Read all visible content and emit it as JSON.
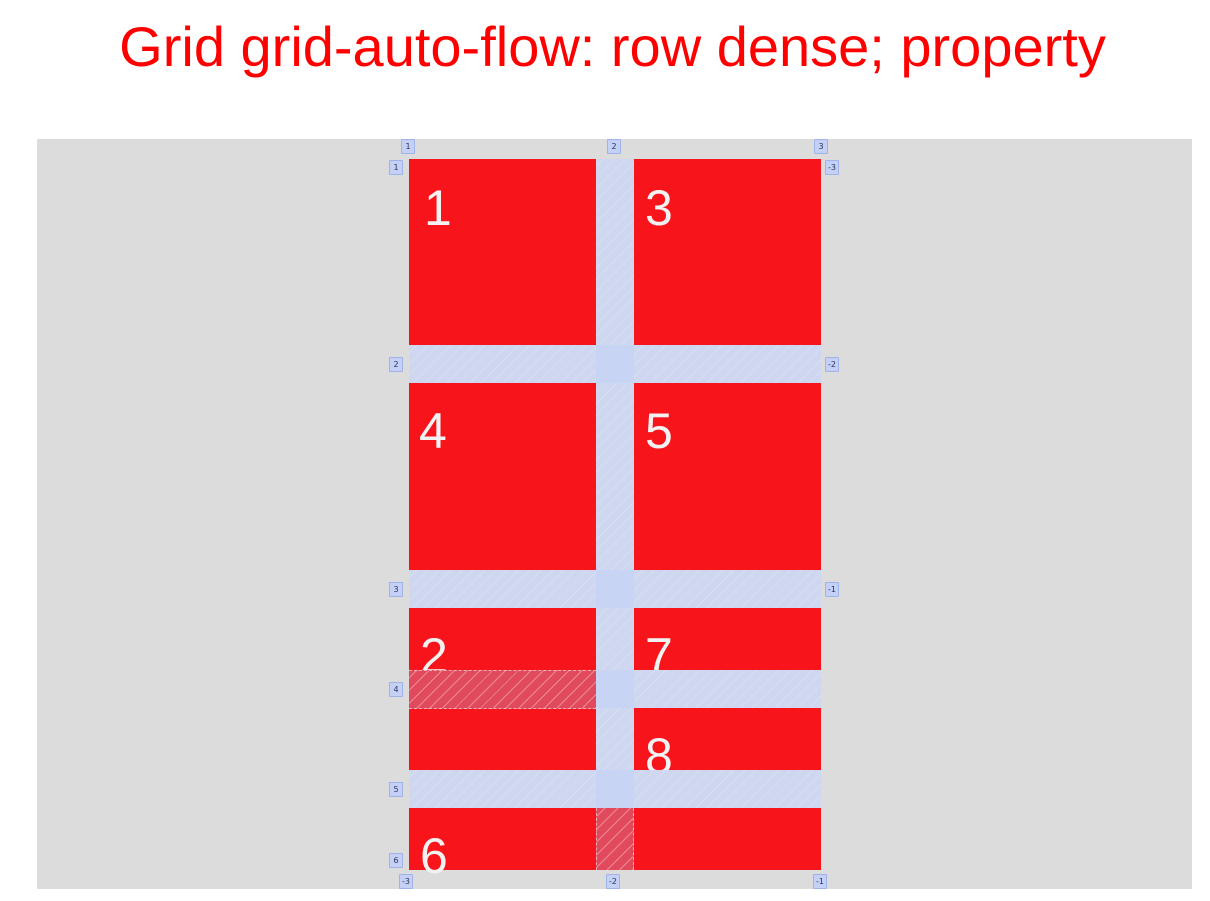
{
  "page": {
    "title": "Grid grid-auto-flow: row dense; property"
  },
  "grid": {
    "items": [
      {
        "label": "1"
      },
      {
        "label": "3"
      },
      {
        "label": "4"
      },
      {
        "label": "5"
      },
      {
        "label": "2"
      },
      {
        "label": "7"
      },
      {
        "label": "8"
      },
      {
        "label": "6"
      }
    ],
    "column_line_labels_top": [
      "1",
      "2",
      "3"
    ],
    "column_line_labels_bottom": [
      "-3",
      "-2",
      "-1"
    ],
    "row_line_labels_left": [
      "1",
      "2",
      "3",
      "4",
      "5",
      "6"
    ],
    "row_line_labels_right": [
      "-3",
      "-2",
      "-1"
    ]
  },
  "colors": {
    "item_background": "#f8141b",
    "item_text": "#f2f2f2",
    "title_text": "#ff0000",
    "container_background": "#dcdcdc",
    "gap_overlay": "#ccd6f0",
    "line_badge": "#c4d0f6"
  }
}
